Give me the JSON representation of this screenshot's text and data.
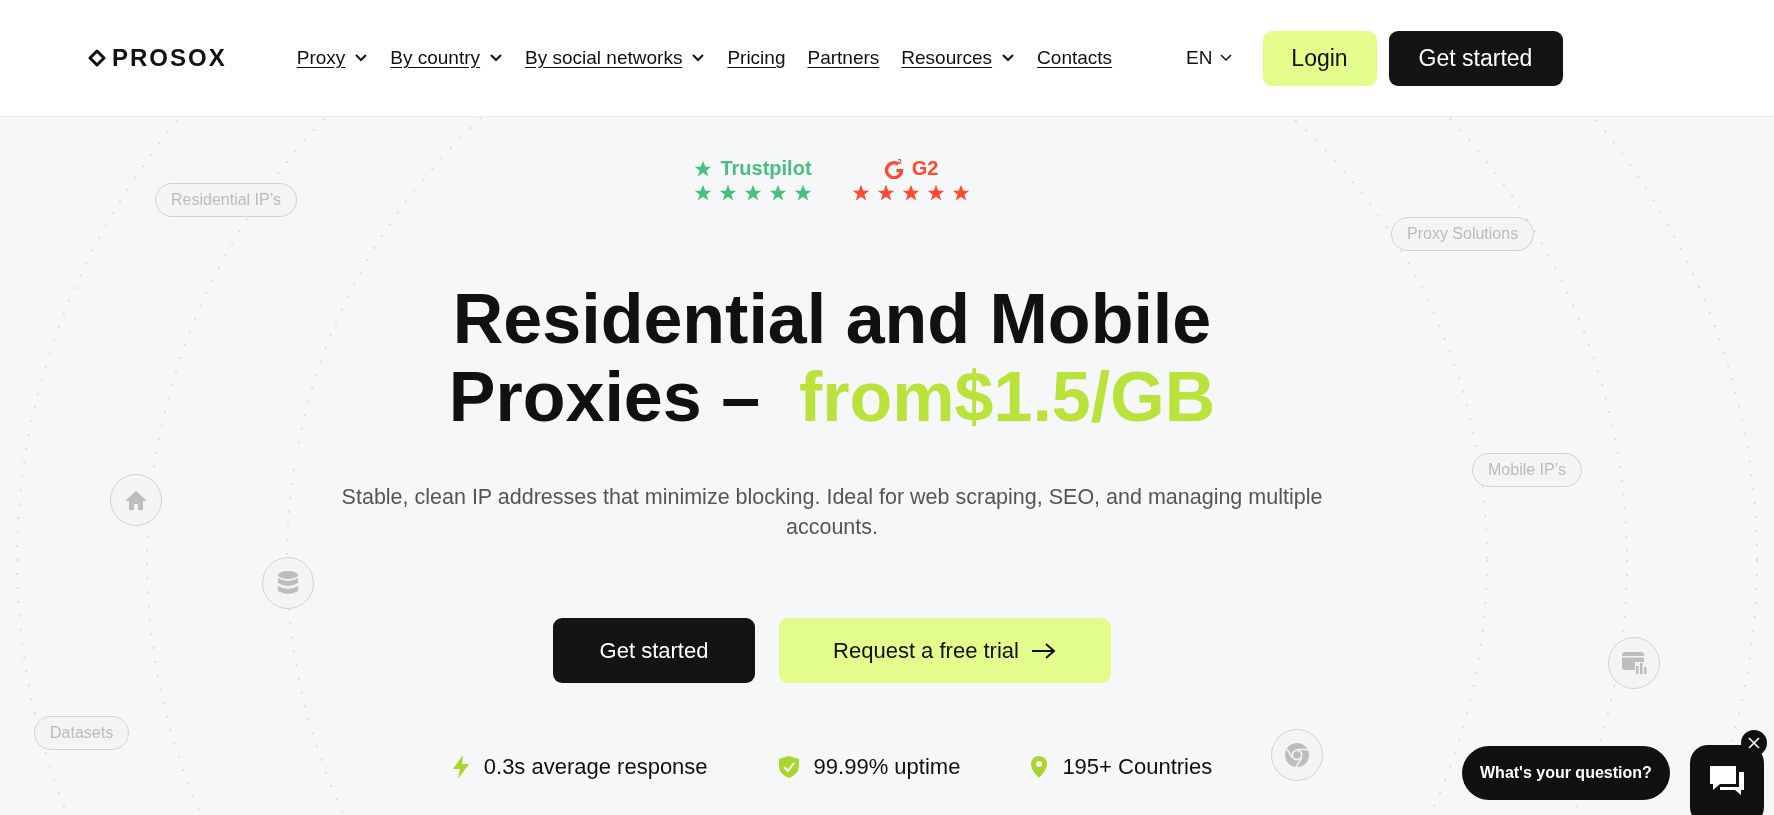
{
  "header": {
    "logo": "PROSOX",
    "nav": [
      {
        "label": "Proxy",
        "dropdown": true
      },
      {
        "label": "By country",
        "dropdown": true
      },
      {
        "label": "By social networks",
        "dropdown": true
      },
      {
        "label": "Pricing",
        "dropdown": false
      },
      {
        "label": "Partners",
        "dropdown": false
      },
      {
        "label": "Resources",
        "dropdown": true
      },
      {
        "label": "Contacts",
        "dropdown": false
      }
    ],
    "language": "EN",
    "login": "Login",
    "cta": "Get started"
  },
  "ratings": [
    {
      "kind": "trustpilot",
      "label": "Trustpilot",
      "stars": 5,
      "color": "#47c07d"
    },
    {
      "kind": "g2",
      "label": "G2",
      "stars": 5,
      "color": "#ff492c"
    }
  ],
  "headline": {
    "lines": [
      "Residential and Mobile",
      "Proxies –"
    ],
    "highlight": "from$1.5/GB"
  },
  "subtitle": "Stable, clean IP addresses that minimize blocking. Ideal for web scraping, SEO, and managing multiple accounts.",
  "buttons": {
    "primary": "Get started",
    "secondary": "Request a free trial"
  },
  "tags": [
    "Residential IP’s",
    "Proxy Solutions",
    "Mobile IP’s",
    "Datasets"
  ],
  "stats": [
    {
      "kind": "speed",
      "text": "0.3s average response"
    },
    {
      "kind": "uptime",
      "text": "99.99% uptime"
    },
    {
      "kind": "location",
      "text": "195+ Countries"
    }
  ],
  "chat": {
    "prompt": "What's your question?"
  }
}
